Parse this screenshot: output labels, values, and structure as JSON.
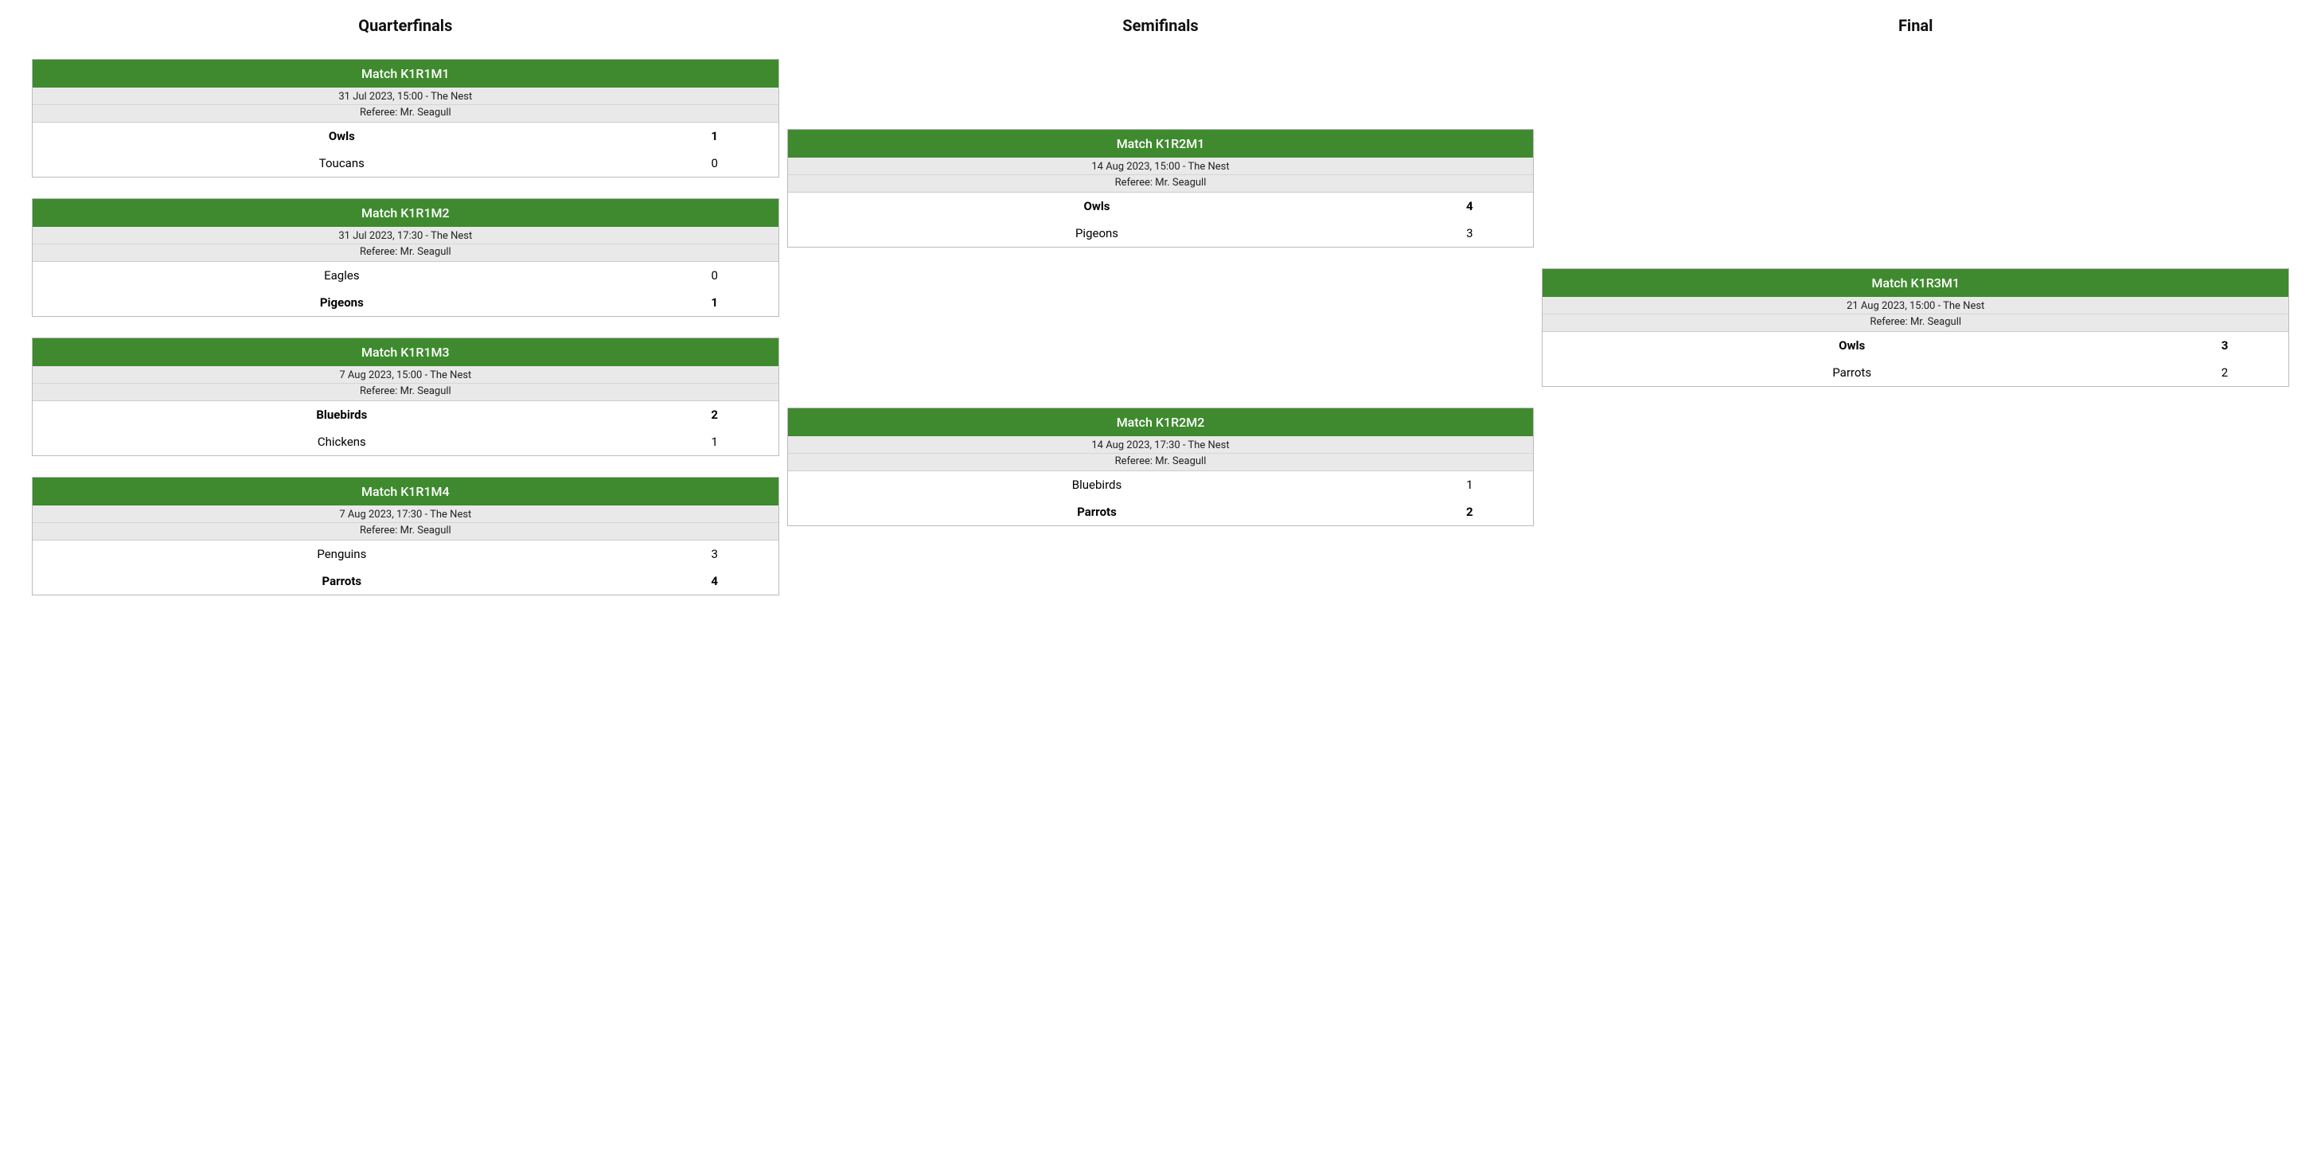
{
  "match_label_prefix": "Match ",
  "referee_prefix": "Referee: ",
  "columns": [
    {
      "title": "Quarterfinals",
      "matches": [
        {
          "id": "K1R1M1",
          "datetime_place": "31 Jul 2023, 15:00 - The Nest",
          "referee": "Mr. Seagull",
          "teams": [
            {
              "name": "Owls",
              "score": "1",
              "winner": true
            },
            {
              "name": "Toucans",
              "score": "0",
              "winner": false
            }
          ]
        },
        {
          "id": "K1R1M2",
          "datetime_place": "31 Jul 2023, 17:30 - The Nest",
          "referee": "Mr. Seagull",
          "teams": [
            {
              "name": "Eagles",
              "score": "0",
              "winner": false
            },
            {
              "name": "Pigeons",
              "score": "1",
              "winner": true
            }
          ]
        },
        {
          "id": "K1R1M3",
          "datetime_place": "7 Aug 2023, 15:00 - The Nest",
          "referee": "Mr. Seagull",
          "teams": [
            {
              "name": "Bluebirds",
              "score": "2",
              "winner": true
            },
            {
              "name": "Chickens",
              "score": "1",
              "winner": false
            }
          ]
        },
        {
          "id": "K1R1M4",
          "datetime_place": "7 Aug 2023, 17:30 - The Nest",
          "referee": "Mr. Seagull",
          "teams": [
            {
              "name": "Penguins",
              "score": "3",
              "winner": false
            },
            {
              "name": "Parrots",
              "score": "4",
              "winner": true
            }
          ]
        }
      ]
    },
    {
      "title": "Semifinals",
      "matches": [
        {
          "id": "K1R2M1",
          "datetime_place": "14 Aug 2023, 15:00 - The Nest",
          "referee": "Mr. Seagull",
          "teams": [
            {
              "name": "Owls",
              "score": "4",
              "winner": true
            },
            {
              "name": "Pigeons",
              "score": "3",
              "winner": false
            }
          ]
        },
        {
          "id": "K1R2M2",
          "datetime_place": "14 Aug 2023, 17:30 - The Nest",
          "referee": "Mr. Seagull",
          "teams": [
            {
              "name": "Bluebirds",
              "score": "1",
              "winner": false
            },
            {
              "name": "Parrots",
              "score": "2",
              "winner": true
            }
          ]
        }
      ]
    },
    {
      "title": "Final",
      "matches": [
        {
          "id": "K1R3M1",
          "datetime_place": "21 Aug 2023, 15:00 - The Nest",
          "referee": "Mr. Seagull",
          "teams": [
            {
              "name": "Owls",
              "score": "3",
              "winner": true
            },
            {
              "name": "Parrots",
              "score": "2",
              "winner": false
            }
          ]
        }
      ]
    }
  ]
}
